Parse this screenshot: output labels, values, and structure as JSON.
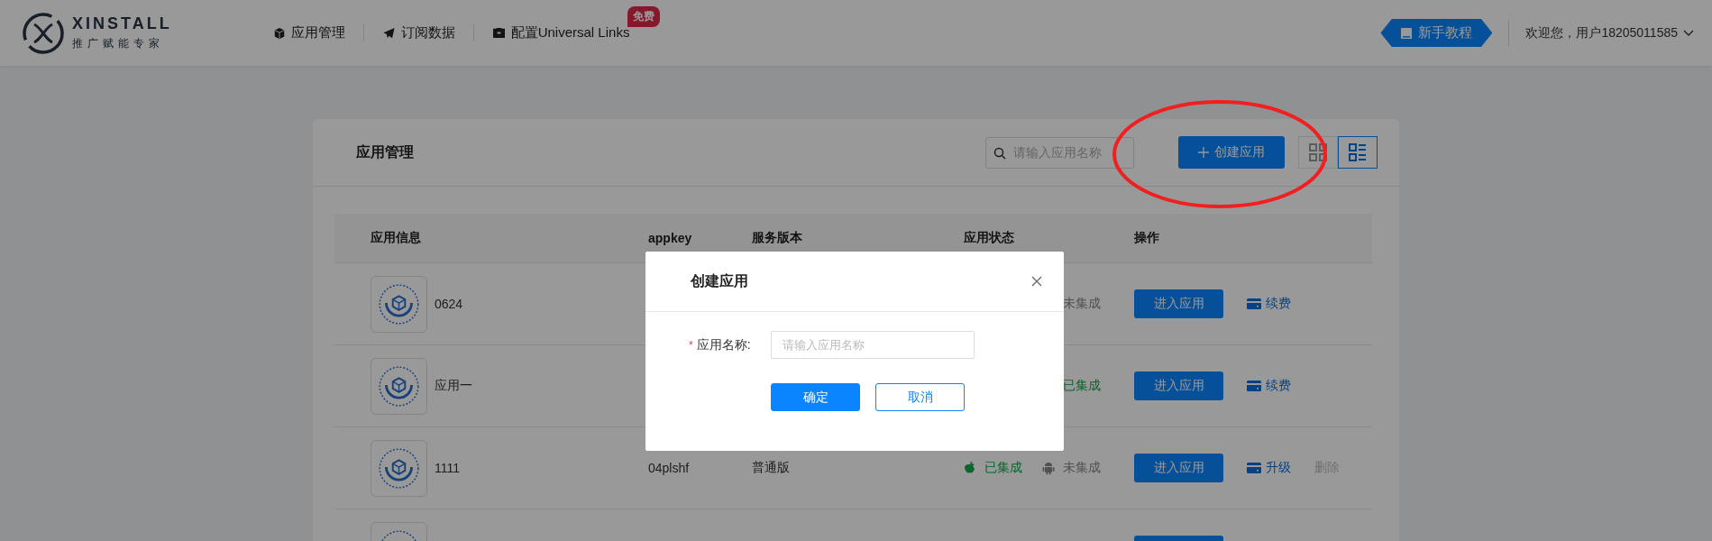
{
  "header": {
    "logo": {
      "name": "XINSTALL",
      "tagline": "推广赋能专家"
    },
    "nav": [
      {
        "label": "应用管理"
      },
      {
        "label": "订阅数据"
      },
      {
        "label": "配置Universal Links",
        "badge": "免费"
      }
    ],
    "tutorial_button": "新手教程",
    "user_menu": "欢迎您，用户18205011585"
  },
  "card": {
    "title": "应用管理",
    "search": {
      "placeholder": "请输入应用名称"
    },
    "create_button": "创建应用",
    "view_toggle": [
      {
        "kind": "grid",
        "selected": false
      },
      {
        "kind": "list",
        "selected": true
      }
    ],
    "table": {
      "columns": [
        "应用信息",
        "appkey",
        "服务版本",
        "应用状态",
        "操作"
      ],
      "rows": [
        {
          "name": "0624",
          "android_status": {
            "text": "未集成",
            "integrated": false
          },
          "enter_button": "进入应用",
          "actions": [
            {
              "kind": "pay",
              "label": "续费",
              "disabled": false
            }
          ]
        },
        {
          "name": "应用一",
          "android_status": {
            "text": "已集成",
            "integrated": true
          },
          "enter_button": "进入应用",
          "actions": [
            {
              "kind": "pay",
              "label": "续费",
              "disabled": false
            }
          ]
        },
        {
          "name": "1111",
          "appkey": "04plshf",
          "version": "普通版",
          "ios_status": {
            "text": "已集成",
            "integrated": true
          },
          "android_status": {
            "text": "未集成",
            "integrated": false
          },
          "enter_button": "进入应用",
          "actions": [
            {
              "kind": "pay",
              "label": "升级",
              "disabled": false
            },
            {
              "kind": "text",
              "label": "删除",
              "disabled": true
            }
          ]
        },
        {}
      ]
    }
  },
  "dialog": {
    "title": "创建应用",
    "field": {
      "label": "应用名称:",
      "required_mark": "*",
      "placeholder": "请输入应用名称"
    },
    "buttons": [
      {
        "label": "确定",
        "kind": "primary"
      },
      {
        "label": "取消",
        "kind": "secondary"
      }
    ]
  }
}
